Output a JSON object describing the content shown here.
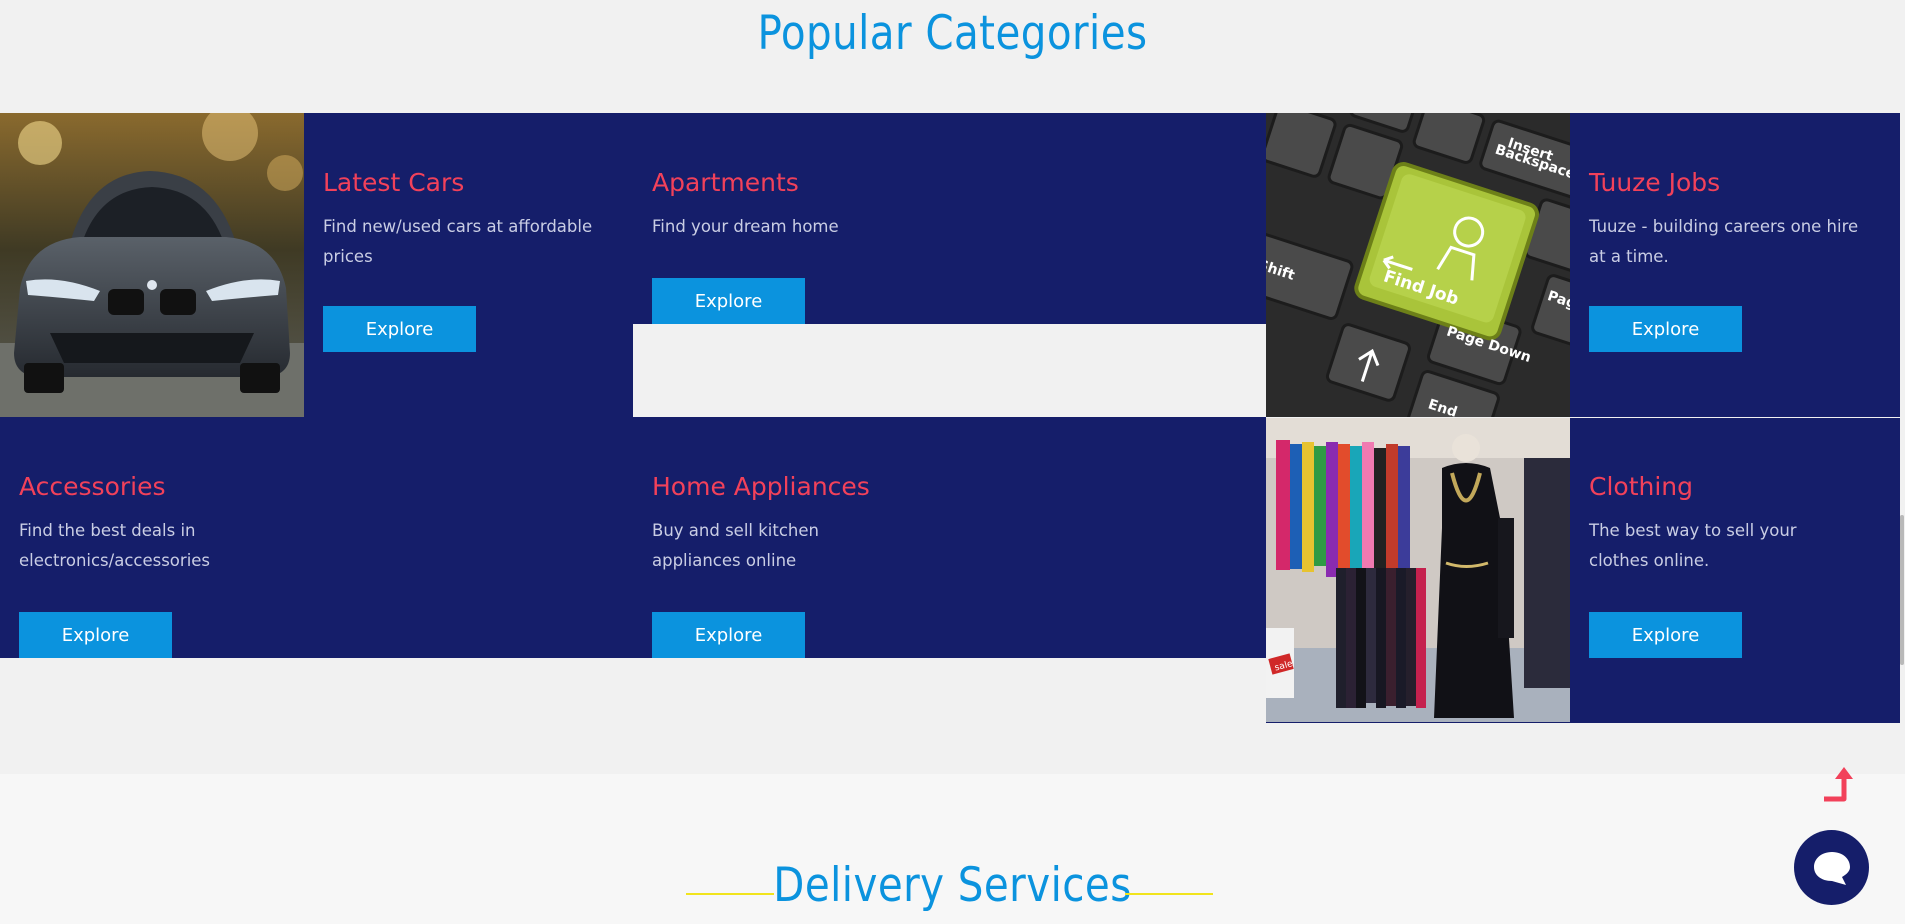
{
  "popular": {
    "title": "Popular Categories",
    "categories": [
      {
        "title": "Latest Cars",
        "desc": "Find new/used cars at affordable prices",
        "button": "Explore"
      },
      {
        "title": "Apartments",
        "desc": "Find your dream home",
        "button": "Explore"
      },
      {
        "title": "Tuuze Jobs",
        "desc": "Tuuze - building careers one hire at a time.",
        "button": "Explore"
      },
      {
        "title": "Accessories",
        "desc": "Find the best deals in electronics/accessories",
        "button": "Explore"
      },
      {
        "title": "Home Appliances",
        "desc": "Buy and sell kitchen appliances online",
        "button": "Explore"
      },
      {
        "title": "Clothing",
        "desc": "The best way to sell your clothes online.",
        "button": "Explore"
      }
    ]
  },
  "photos": {
    "keyboard": {
      "key_label": "Find Job",
      "keys": [
        "Insert",
        "Backspace",
        "Shift",
        "Page Up",
        "Page Down",
        "End"
      ]
    },
    "clothing": {
      "sale_sign": "sale"
    }
  },
  "delivery": {
    "title": "Delivery Services"
  },
  "widgets": {
    "scroll_top_icon": "arrow-up-icon",
    "chat_icon": "chat-bubble-icon"
  },
  "colors": {
    "navy": "#151e6a",
    "accent_blue": "#0b93de",
    "title_red": "#f2415a",
    "divider_yellow": "#f1e41d"
  }
}
